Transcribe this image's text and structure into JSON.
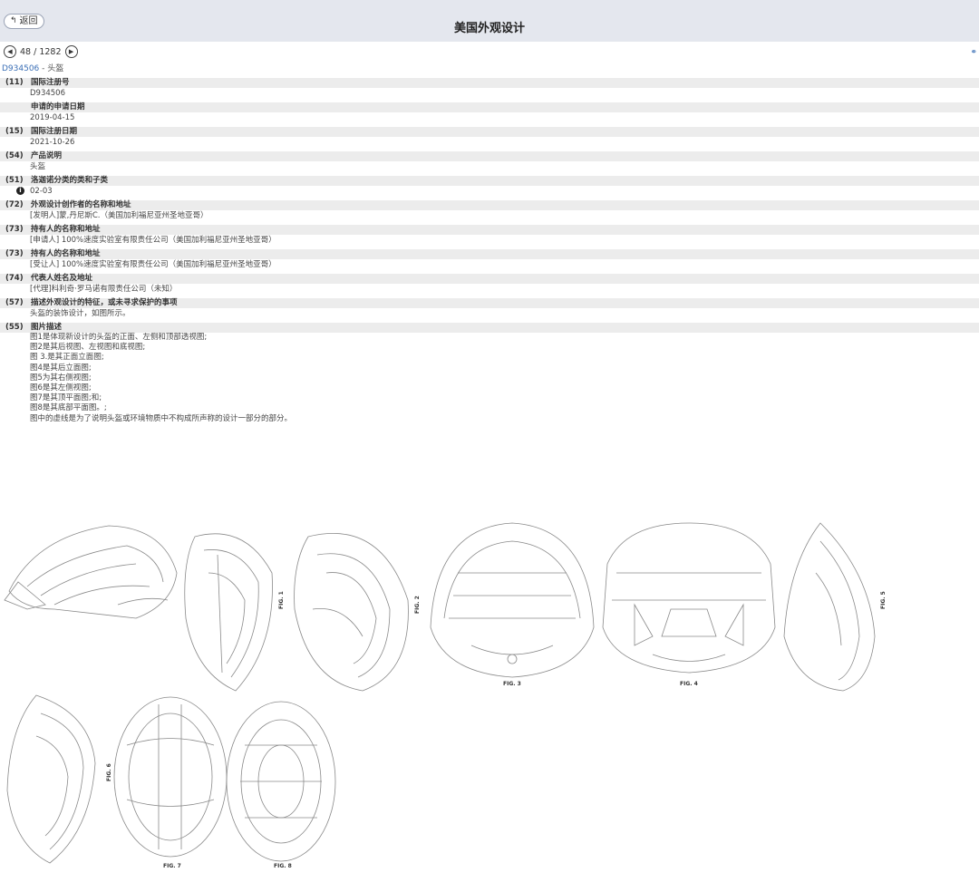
{
  "header": {
    "back_label": "返回",
    "title": "美国外观设计"
  },
  "pager": {
    "current": "48 / 1282"
  },
  "subhead": {
    "number": "D934506",
    "separator": " - ",
    "name": "头盔"
  },
  "fields": [
    {
      "code": "(11)",
      "label": "国际注册号",
      "value": "D934506"
    },
    {
      "code": "",
      "label": "申请的申请日期",
      "value": "2019-04-15"
    },
    {
      "code": "(15)",
      "label": "国际注册日期",
      "value": "2021-10-26"
    },
    {
      "code": "(54)",
      "label": "产品说明",
      "value": "头盔"
    },
    {
      "code": "(51)",
      "label": "洛迦诺分类的类和子类",
      "value": "02-03"
    },
    {
      "code": "(72)",
      "label": "外观设计创作者的名称和地址",
      "value": "[发明人]蒙,丹尼斯C.（美国加利福尼亚州圣地亚哥）"
    },
    {
      "code": "(73)",
      "label": "持有人的名称和地址",
      "value": "[申请人] 100%速度实验室有限责任公司（美国加利福尼亚州圣地亚哥）"
    },
    {
      "code": "(73)",
      "label": "持有人的名称和地址",
      "value": "[受让人] 100%速度实验室有限责任公司（美国加利福尼亚州圣地亚哥）"
    },
    {
      "code": "(74)",
      "label": "代表人姓名及地址",
      "value": "[代理]科利奇·罗马诺有限责任公司（未知）"
    },
    {
      "code": "(57)",
      "label": "描述外观设计的特征，或未寻求保护的事项",
      "value": "头盔的装饰设计，如图所示。"
    }
  ],
  "description": {
    "code": "(55)",
    "label": "图片描述",
    "lines": [
      "图1是体现新设计的头盔的正面、左侧和顶部透视图;",
      "图2是其后视图、左视图和底视图;",
      "图 3.是其正面立面图;",
      "图4是其后立面图;",
      "图5为其右侧视图;",
      "图6是其左侧视图;",
      "图7是其顶平面图;和;",
      "图8是其底部平面图。;",
      "图中的虚线是为了说明头盔或环境物质中不构成所声称的设计一部分的部分。"
    ]
  },
  "figures": {
    "fig1": "FIG. 1",
    "fig2": "FIG. 2",
    "fig3": "FIG. 3",
    "fig4": "FIG. 4",
    "fig5": "FIG. 5",
    "fig6": "FIG. 6",
    "fig7": "FIG. 7",
    "fig8": "FIG. 8"
  },
  "icons": {
    "back": "back-arrow-icon",
    "prev": "prev-page-icon",
    "next": "next-page-icon",
    "link": "link-icon",
    "info": "info-icon"
  },
  "colors": {
    "header_bg": "#e4e7ee",
    "field_header_bg": "#ececec",
    "link": "#3b6fb6"
  }
}
